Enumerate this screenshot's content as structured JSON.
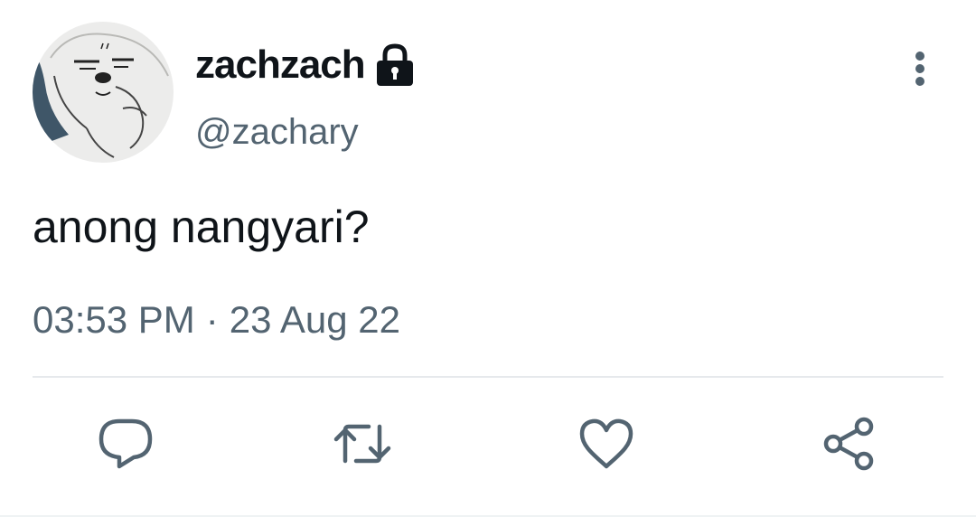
{
  "tweet": {
    "display_name": "zachzach",
    "handle": "@zachary",
    "text": "anong nangyari?",
    "time": "03:53 PM",
    "separator": "·",
    "date": "23 Aug 22"
  },
  "icons": {
    "protected": "lock-icon",
    "more": "more-vertical-icon",
    "reply": "reply-icon",
    "retweet": "retweet-icon",
    "like": "heart-icon",
    "share": "share-icon"
  },
  "colors": {
    "text_primary": "#0f1419",
    "text_secondary": "#536471",
    "icon": "#536471",
    "divider": "#e6e9ec"
  }
}
